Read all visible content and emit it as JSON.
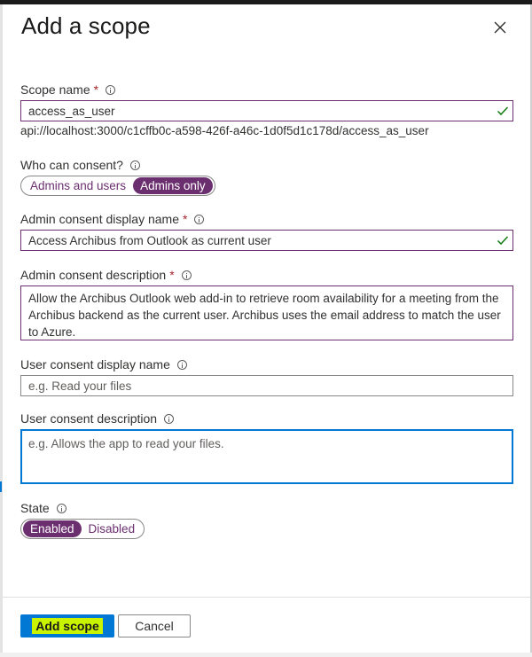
{
  "dialog": {
    "title": "Add a scope"
  },
  "scope_name": {
    "label": "Scope name",
    "required_mark": "*",
    "value": "access_as_user",
    "uri": "api://localhost:3000/c1cffb0c-a598-426f-a46c-1d0f5d1c178d/access_as_user"
  },
  "who_can_consent": {
    "label": "Who can consent?",
    "options": [
      "Admins and users",
      "Admins only"
    ],
    "selected": "Admins only"
  },
  "admin_display": {
    "label": "Admin consent display name",
    "required_mark": "*",
    "value": "Access Archibus from Outlook as current user"
  },
  "admin_description": {
    "label": "Admin consent description",
    "required_mark": "*",
    "value": "Allow the Archibus Outlook web add-in to retrieve room availability for a meeting from the Archibus backend as the current user. Archibus uses the email address to match the user to Azure."
  },
  "user_display": {
    "label": "User consent display name",
    "placeholder": "e.g. Read your files"
  },
  "user_description": {
    "label": "User consent description",
    "placeholder": "e.g. Allows the app to read your files."
  },
  "state": {
    "label": "State",
    "options": [
      "Enabled",
      "Disabled"
    ],
    "selected": "Enabled"
  },
  "actions": {
    "add_label": "Add scope",
    "cancel_label": "Cancel"
  },
  "colors": {
    "accent_purple": "#6b2e6f",
    "primary_blue": "#0078d4",
    "highlight": "#c8f400",
    "valid_green": "#107c10",
    "required_red": "#a4262c"
  },
  "icons": {
    "close": "close-icon",
    "info": "info-icon",
    "valid": "checkmark-icon"
  }
}
